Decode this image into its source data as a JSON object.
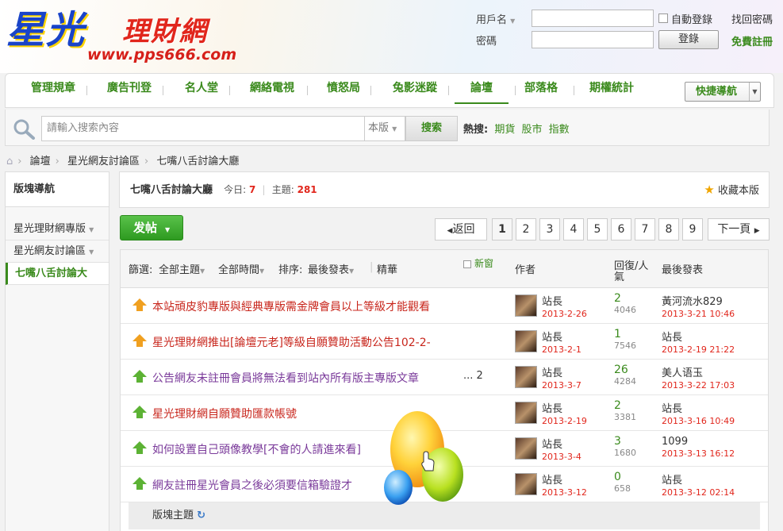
{
  "logo": {
    "main": "星光",
    "sub": "理財網",
    "url": "www.pps666.com"
  },
  "login": {
    "user_label": "用戶名",
    "pass_label": "密碼",
    "auto_login": "自動登錄",
    "forgot": "找回密碼",
    "login_btn": "登錄",
    "register": "免費註冊"
  },
  "nav": {
    "items": [
      "管理規章",
      "廣告刊登",
      "名人堂",
      "網絡電視",
      "憤怒局",
      "兔影迷蹤",
      "論壇",
      "部落格",
      "期權統計"
    ],
    "active_index": 6,
    "quick_label": "快捷導航"
  },
  "search": {
    "placeholder": "請輸入搜索內容",
    "scope": "本版",
    "button": "搜索",
    "hot_label": "熱搜:",
    "hot_items": [
      "期貨",
      "股市",
      "指數"
    ]
  },
  "breadcrumb": [
    "論壇",
    "星光網友討論區",
    "七嘴八舌討論大廳"
  ],
  "sidebar": {
    "title": "版塊導航",
    "items": [
      "星光理財網專版",
      "星光網友討論區",
      "七嘴八舌討論大"
    ]
  },
  "forum": {
    "name": "七嘴八舌討論大廳",
    "today_label": "今日:",
    "today": "7",
    "topics_label": "主題:",
    "topics": "281",
    "favorite": "收藏本版"
  },
  "post_btn": "发帖",
  "pager": {
    "back": "返回",
    "pages": [
      "1",
      "2",
      "3",
      "4",
      "5",
      "6",
      "7",
      "8",
      "9"
    ],
    "current": "1",
    "next": "下一頁"
  },
  "filters": {
    "label": "篩選:",
    "all_topics": "全部主題",
    "all_time": "全部時間",
    "sort_label": "排序:",
    "sort_value": "最後發表",
    "digest": "精華",
    "new_window": "新窗",
    "col_author": "作者",
    "col_replies": "回復/人氣",
    "col_last": "最後發表"
  },
  "threads": [
    {
      "title": "本站頑皮豹專版與經典專版需金牌會員以上等級才能觀看",
      "author": "站長",
      "date": "2013-2-26",
      "replies": "2",
      "views": "4046",
      "last_user": "黃河流水829",
      "last_date": "2013-3-21 10:46",
      "type": "announce"
    },
    {
      "title": "星光理財網推出[論壇元老]等級自願贊助活動公告102-2-",
      "author": "站長",
      "date": "2013-2-1",
      "replies": "1",
      "views": "7546",
      "last_user": "站長",
      "last_date": "2013-2-19 21:22",
      "type": "announce"
    },
    {
      "title": "公告網友未註冊會員將無法看到站內所有版主專版文章",
      "pages": "... 2",
      "author": "站長",
      "date": "2013-3-7",
      "replies": "26",
      "views": "4284",
      "last_user": "美人语玉",
      "last_date": "2013-3-22 17:03",
      "type": "sticky"
    },
    {
      "title": "星光理財網自願贊助匯款帳號",
      "author": "站長",
      "date": "2013-2-19",
      "replies": "2",
      "views": "3381",
      "last_user": "站長",
      "last_date": "2013-3-16 10:49",
      "type": "sticky"
    },
    {
      "title": "如何設置自己頭像教學[不會的人請進來看]",
      "author": "站長",
      "date": "2013-3-4",
      "replies": "3",
      "views": "1680",
      "last_user": "1099",
      "last_date": "2013-3-13 16:12",
      "type": "sticky"
    },
    {
      "title": "網友註冊星光會員之後必須要信箱驗證才",
      "author": "站長",
      "date": "2013-3-12",
      "replies": "0",
      "views": "658",
      "last_user": "站長",
      "last_date": "2013-3-12 02:14",
      "type": "sticky"
    }
  ],
  "section_label": "版塊主題"
}
